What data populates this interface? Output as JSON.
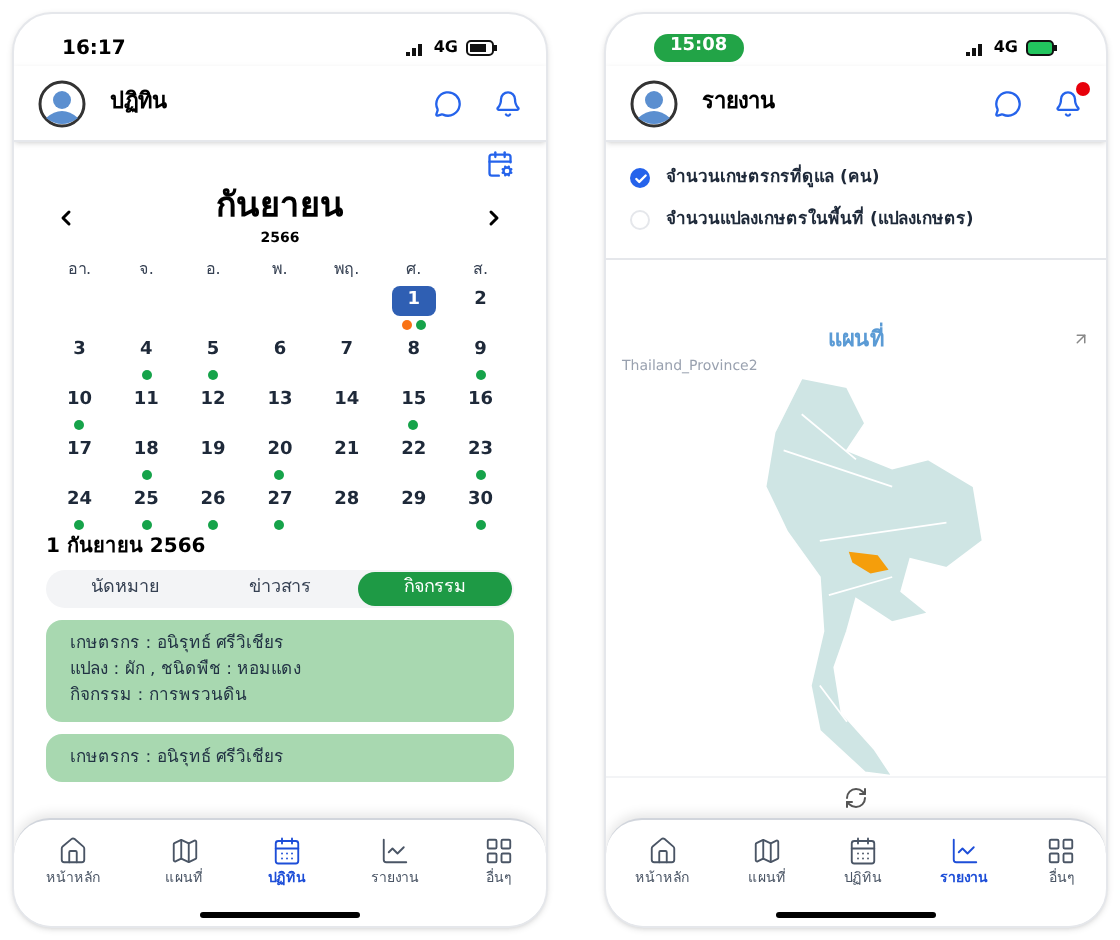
{
  "calendar_screen": {
    "status_bar": {
      "time": "16:17",
      "network": "4G"
    },
    "header": {
      "title": "ปฏิทิน"
    },
    "calendar": {
      "month": "กันยายน",
      "year": "2566",
      "weekdays": [
        "อา.",
        "จ.",
        "อ.",
        "พ.",
        "พฤ.",
        "ศ.",
        "ส."
      ],
      "weeks": [
        [
          {
            "kind": "blank"
          },
          {
            "kind": "blank"
          },
          {
            "kind": "blank"
          },
          {
            "kind": "blank"
          },
          {
            "kind": "blank"
          },
          {
            "kind": "day",
            "label": "1",
            "selected": true,
            "dots": [
              {
                "color": "#f97316"
              },
              {
                "color": "#16a34a"
              }
            ]
          },
          {
            "kind": "day",
            "label": "2",
            "selected": false
          }
        ],
        [
          {
            "kind": "day",
            "label": "3",
            "selected": false
          },
          {
            "kind": "day",
            "label": "4",
            "selected": false,
            "dots": [
              {
                "color": "#16a34a"
              }
            ]
          },
          {
            "kind": "day",
            "label": "5",
            "selected": false,
            "dots": [
              {
                "color": "#16a34a"
              }
            ]
          },
          {
            "kind": "day",
            "label": "6",
            "selected": false
          },
          {
            "kind": "day",
            "label": "7",
            "selected": false
          },
          {
            "kind": "day",
            "label": "8",
            "selected": false
          },
          {
            "kind": "day",
            "label": "9",
            "selected": false,
            "dots": [
              {
                "color": "#16a34a"
              }
            ]
          }
        ],
        [
          {
            "kind": "day",
            "label": "10",
            "selected": false,
            "dots": [
              {
                "color": "#16a34a"
              }
            ]
          },
          {
            "kind": "day",
            "label": "11",
            "selected": false
          },
          {
            "kind": "day",
            "label": "12",
            "selected": false
          },
          {
            "kind": "day",
            "label": "13",
            "selected": false
          },
          {
            "kind": "day",
            "label": "14",
            "selected": false
          },
          {
            "kind": "day",
            "label": "15",
            "selected": false,
            "dots": [
              {
                "color": "#16a34a"
              }
            ]
          },
          {
            "kind": "day",
            "label": "16",
            "selected": false
          }
        ],
        [
          {
            "kind": "day",
            "label": "17",
            "selected": false
          },
          {
            "kind": "day",
            "label": "18",
            "selected": false,
            "dots": [
              {
                "color": "#16a34a"
              }
            ]
          },
          {
            "kind": "day",
            "label": "19",
            "selected": false
          },
          {
            "kind": "day",
            "label": "20",
            "selected": false,
            "dots": [
              {
                "color": "#16a34a"
              }
            ]
          },
          {
            "kind": "day",
            "label": "21",
            "selected": false
          },
          {
            "kind": "day",
            "label": "22",
            "selected": false
          },
          {
            "kind": "day",
            "label": "23",
            "selected": false,
            "dots": [
              {
                "color": "#16a34a"
              }
            ]
          }
        ],
        [
          {
            "kind": "day",
            "label": "24",
            "selected": false,
            "dots": [
              {
                "color": "#16a34a"
              }
            ]
          },
          {
            "kind": "day",
            "label": "25",
            "selected": false,
            "dots": [
              {
                "color": "#16a34a"
              }
            ]
          },
          {
            "kind": "day",
            "label": "26",
            "selected": false,
            "dots": [
              {
                "color": "#16a34a"
              }
            ]
          },
          {
            "kind": "day",
            "label": "27",
            "selected": false,
            "dots": [
              {
                "color": "#16a34a"
              }
            ]
          },
          {
            "kind": "day",
            "label": "28",
            "selected": false
          },
          {
            "kind": "day",
            "label": "29",
            "selected": false
          },
          {
            "kind": "day",
            "label": "30",
            "selected": false,
            "dots": [
              {
                "color": "#16a34a"
              }
            ]
          }
        ]
      ]
    },
    "selected_date": "1 กันยายน 2566",
    "tabs": [
      {
        "label": "นัดหมาย",
        "selected": false
      },
      {
        "label": "ข่าวสาร",
        "selected": false
      },
      {
        "label": "กิจกรรม",
        "selected": true
      }
    ],
    "cards": [
      {
        "lines": [
          "เกษตรกร : อนิรุทธ์ ศรีวิเชียร",
          "แปลง : ผัก , ชนิดพืช : หอมแดง",
          "กิจกรรม : การพรวนดิน"
        ]
      },
      {
        "lines": [
          "เกษตรกร : อนิรุทธ์ ศรีวิเชียร"
        ]
      }
    ],
    "nav": [
      {
        "label": "หน้าหลัก",
        "selected": false
      },
      {
        "label": "แผนที่",
        "selected": false
      },
      {
        "label": "ปฏิทิน",
        "selected": true
      },
      {
        "label": "รายงาน",
        "selected": false
      },
      {
        "label": "อื่นๆ",
        "selected": false
      }
    ]
  },
  "report_screen": {
    "status_bar": {
      "time": "15:08",
      "network": "4G"
    },
    "header": {
      "title": "รายงาน",
      "notification_badge": true
    },
    "options": [
      {
        "label": "จำนวนเกษตรกรที่ดูแล (คน)",
        "selected": true
      },
      {
        "label": "จำนวนแปลงเกษตรในพื้นที่ (แปลงเกษตร)",
        "selected": false
      }
    ],
    "map": {
      "title": "แผนที่",
      "layer": "Thailand_Province2"
    },
    "nav": [
      {
        "label": "หน้าหลัก",
        "selected": false
      },
      {
        "label": "แผนที่",
        "selected": false
      },
      {
        "label": "ปฏิทิน",
        "selected": false
      },
      {
        "label": "รายงาน",
        "selected": true
      },
      {
        "label": "อื่นๆ",
        "selected": false
      }
    ]
  }
}
